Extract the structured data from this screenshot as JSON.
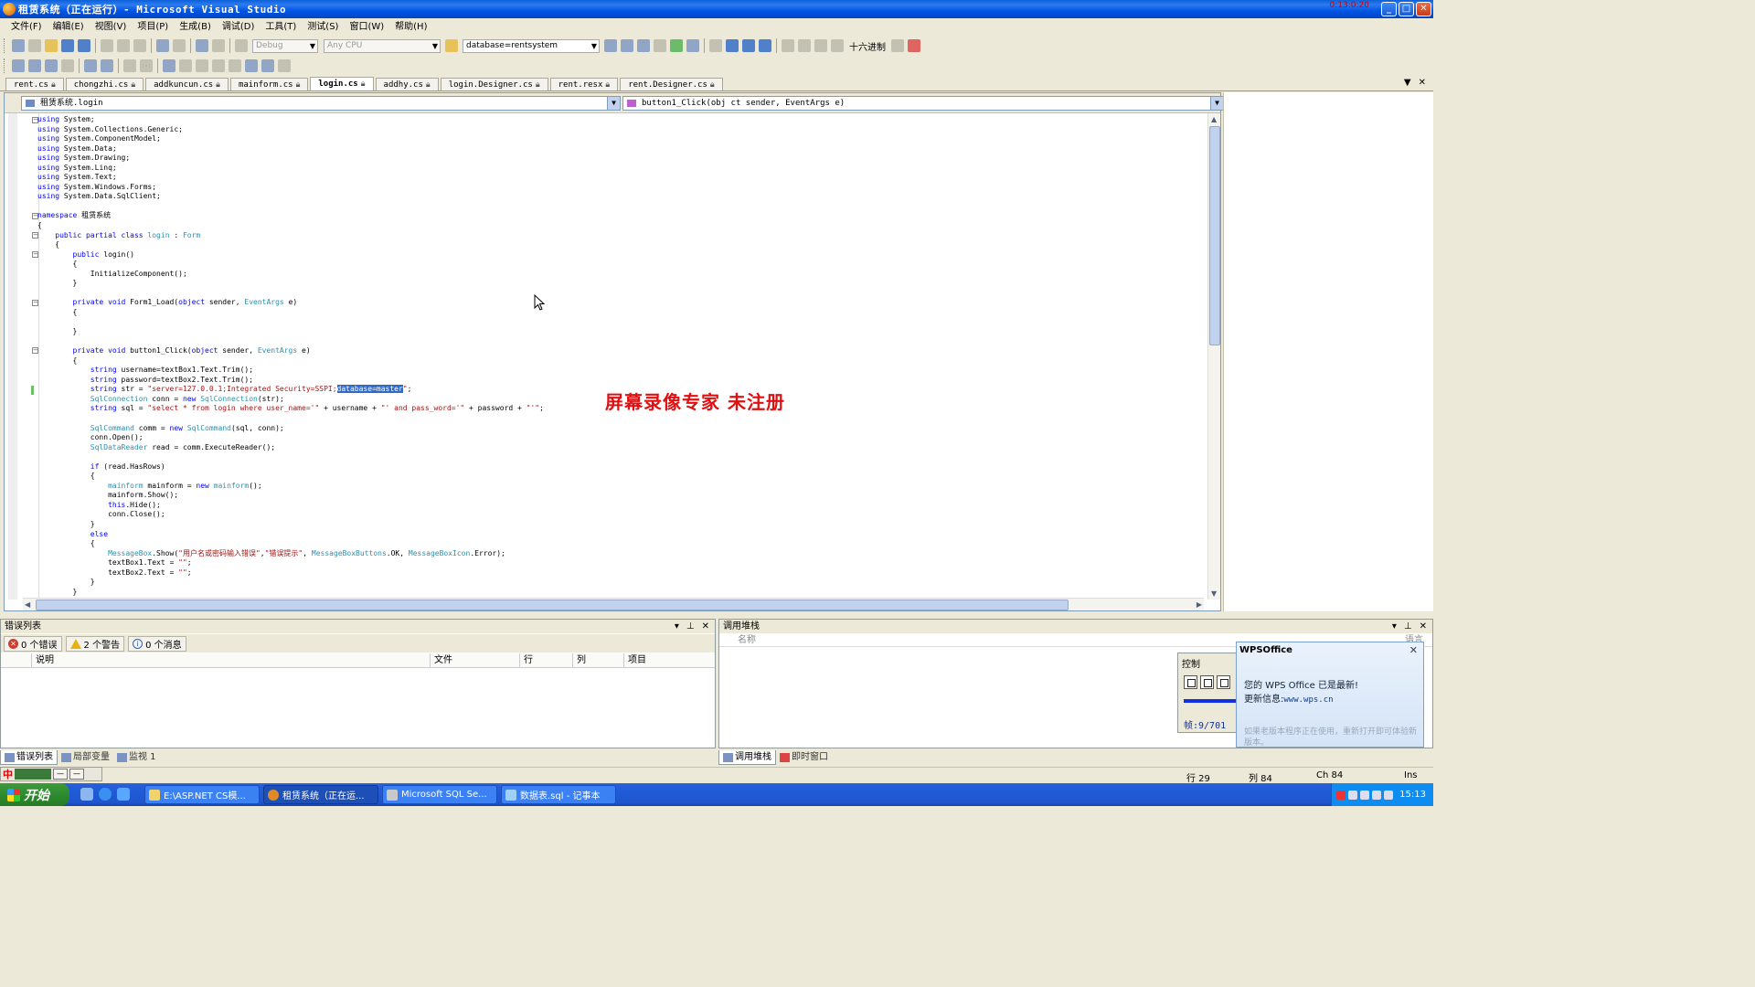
{
  "window": {
    "title": "租赁系统（正在运行）- Microsoft Visual Studio",
    "rec_badge": "0:13:0:20"
  },
  "menu": [
    "文件(F)",
    "编辑(E)",
    "视图(V)",
    "项目(P)",
    "生成(B)",
    "调试(D)",
    "工具(T)",
    "测试(S)",
    "窗口(W)",
    "帮助(H)"
  ],
  "toolbar": {
    "config": "Debug",
    "platform": "Any CPU",
    "find_text": "database=rentsystem",
    "hex_label": "十六进制"
  },
  "doc_tabs": [
    {
      "label": "rent.cs",
      "active": false
    },
    {
      "label": "chongzhi.cs",
      "active": false
    },
    {
      "label": "addkuncun.cs",
      "active": false
    },
    {
      "label": "mainform.cs",
      "active": false
    },
    {
      "label": "login.cs",
      "active": true
    },
    {
      "label": "addhy.cs",
      "active": false
    },
    {
      "label": "login.Designer.cs",
      "active": false
    },
    {
      "label": "rent.resx",
      "active": false
    },
    {
      "label": "rent.Designer.cs",
      "active": false
    }
  ],
  "nav": {
    "class_combo": "租赁系统.login",
    "member_combo": "button1_Click(obj ct sender, EventArgs e)"
  },
  "watermark": "屏幕录像专家  未注册",
  "error_list": {
    "title": "错误列表",
    "errors": "0 个错误",
    "warnings": "2 个警告",
    "messages": "0 个消息",
    "columns": [
      "说明",
      "文件",
      "行",
      "列",
      "项目"
    ],
    "tabs": [
      "错误列表",
      "局部变量",
      "监视 1"
    ]
  },
  "call_stack": {
    "title": "调用堆栈",
    "col_name": "名称",
    "col_lang": "语言",
    "tabs": [
      "调用堆栈",
      "即时窗口"
    ]
  },
  "recorder": {
    "label": "控制",
    "frame": "帧:9/701"
  },
  "wps": {
    "header": "WPSOffice",
    "line1": "您的 WPS Office 已是最新!",
    "line2_prefix": "更新信息:",
    "line2_link": "www.wps.cn",
    "line3": "如果老版本程序正在使用，重新打开即可体验新版本。"
  },
  "status": {
    "row": "行 29",
    "col": "列 84",
    "ch": "Ch 84",
    "mode": "Ins"
  },
  "taskbar": {
    "start": "开始",
    "buttons": [
      {
        "label": "E:\\ASP.NET CS模..."
      },
      {
        "label": "租赁系统（正在运..."
      },
      {
        "label": "Microsoft SQL Se..."
      },
      {
        "label": "数据表.sql - 记事本"
      }
    ],
    "clock": "15:13"
  }
}
